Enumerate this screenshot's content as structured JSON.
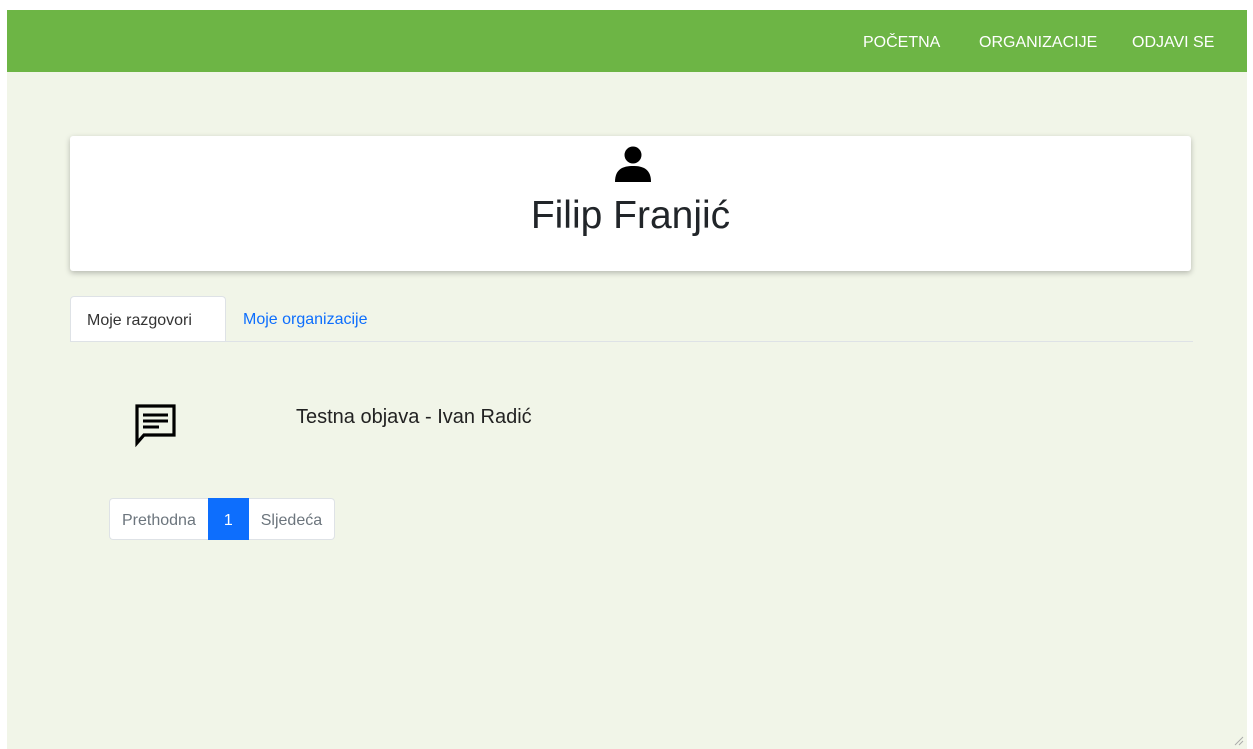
{
  "nav": {
    "home": "POČETNA",
    "organizations": "ORGANIZACIJE",
    "logout": "ODJAVI SE"
  },
  "profile": {
    "icon": "user-icon",
    "name": "Filip Franjić"
  },
  "tabs": {
    "conversations": "Moje razgovori",
    "organizations": "Moje organizacije"
  },
  "conversations": [
    {
      "icon": "message-icon",
      "title": "Testna objava - Ivan Radić"
    }
  ],
  "pagination": {
    "previous": "Prethodna",
    "current": "1",
    "next": "Sljedeća"
  },
  "colors": {
    "navbar": "#6db545",
    "background": "#f1f5e8",
    "link": "#0d6efd",
    "active_page": "#0d6efd"
  }
}
